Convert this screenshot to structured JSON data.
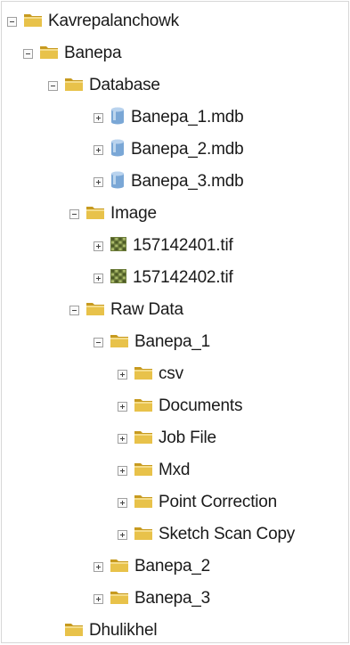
{
  "tree": [
    {
      "label": "Kavrepalanchowk",
      "icon": "folder-icon",
      "expander": "minus"
    },
    {
      "label": "Banepa",
      "icon": "folder-icon",
      "expander": "minus"
    },
    {
      "label": "Database",
      "icon": "folder-icon",
      "expander": "minus"
    },
    {
      "label": "Banepa_1.mdb",
      "icon": "database-icon",
      "expander": "plus"
    },
    {
      "label": "Banepa_2.mdb",
      "icon": "database-icon",
      "expander": "plus"
    },
    {
      "label": "Banepa_3.mdb",
      "icon": "database-icon",
      "expander": "plus"
    },
    {
      "label": "Image",
      "icon": "folder-icon",
      "expander": "minus"
    },
    {
      "label": "157142401.tif",
      "icon": "raster-icon",
      "expander": "plus"
    },
    {
      "label": "157142402.tif",
      "icon": "raster-icon",
      "expander": "plus"
    },
    {
      "label": "Raw Data",
      "icon": "folder-icon",
      "expander": "minus"
    },
    {
      "label": "Banepa_1",
      "icon": "folder-icon",
      "expander": "minus"
    },
    {
      "label": "csv",
      "icon": "folder-icon",
      "expander": "plus"
    },
    {
      "label": "Documents",
      "icon": "folder-icon",
      "expander": "plus"
    },
    {
      "label": "Job File",
      "icon": "folder-icon",
      "expander": "plus"
    },
    {
      "label": "Mxd",
      "icon": "folder-icon",
      "expander": "plus"
    },
    {
      "label": "Point Correction",
      "icon": "folder-icon",
      "expander": "plus"
    },
    {
      "label": "Sketch Scan Copy",
      "icon": "folder-icon",
      "expander": "plus"
    },
    {
      "label": "Banepa_2",
      "icon": "folder-icon",
      "expander": "plus"
    },
    {
      "label": "Banepa_3",
      "icon": "folder-icon",
      "expander": "plus"
    },
    {
      "label": "Dhulikhel",
      "icon": "folder-icon",
      "expander": "none"
    }
  ],
  "colors": {
    "folder": "#e8c24a",
    "folder_dark": "#c79a1f",
    "database": "#7aa7d6",
    "raster": "#6b7b3a"
  }
}
